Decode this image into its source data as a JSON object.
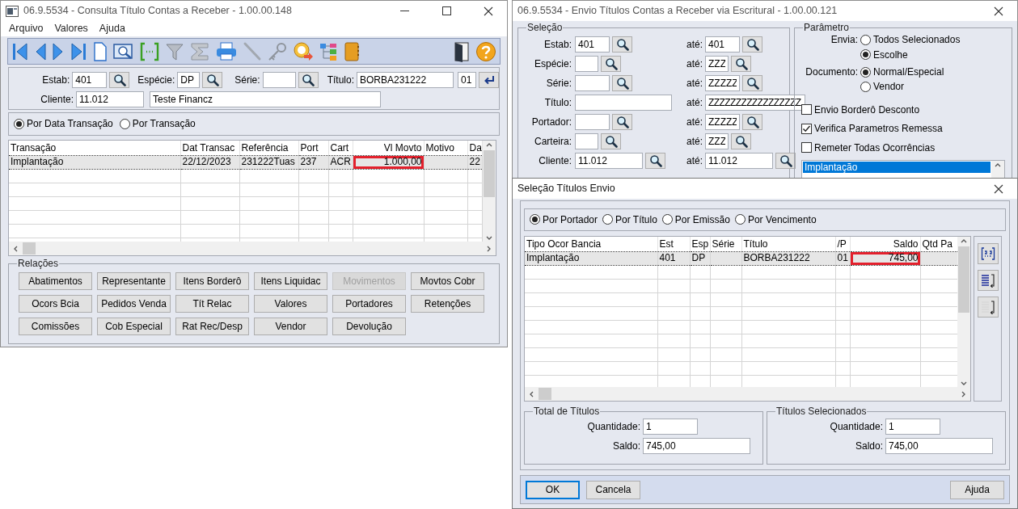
{
  "consulta": {
    "title": "06.9.5534 - Consulta Título Contas a Receber - 1.00.00.148",
    "menu": [
      "Arquivo",
      "Valores",
      "Ajuda"
    ],
    "filter": {
      "estab_label": "Estab:",
      "estab": "401",
      "especie_label": "Espécie:",
      "especie": "DP",
      "serie_label": "Série:",
      "titulo_label": "Título:",
      "titulo": "BORBA231222",
      "parcela": "01",
      "cliente_label": "Cliente:",
      "cliente": "11.012",
      "cliente_nome": "Teste Financz"
    },
    "order_options": [
      {
        "label": "Por Data Transação",
        "selected": true
      },
      {
        "label": "Por Transação",
        "selected": false
      }
    ],
    "grid": {
      "columns": [
        {
          "label": "Transação",
          "kind": "text",
          "highlighted": false
        },
        {
          "label": "Dat Transac",
          "kind": "text",
          "highlighted": false
        },
        {
          "label": "Referência",
          "kind": "text",
          "highlighted": false
        },
        {
          "label": "Port",
          "kind": "text",
          "highlighted": false
        },
        {
          "label": "Cart",
          "kind": "text",
          "highlighted": false
        },
        {
          "label": "Vl Movto",
          "kind": "number",
          "highlighted": true
        },
        {
          "label": "Motivo",
          "kind": "text",
          "highlighted": false
        },
        {
          "label": "Da",
          "kind": "text",
          "highlighted": false
        }
      ],
      "rows": [
        {
          "selected": true,
          "cells": [
            "Implantação",
            "22/12/2023",
            "231222Tuas",
            "237",
            "ACR",
            "1.000,00",
            null,
            "22"
          ]
        }
      ]
    },
    "relations": {
      "title": "Relações",
      "buttons": [
        {
          "label": "Abatimentos",
          "disabled": false
        },
        {
          "label": "Representante",
          "disabled": false
        },
        {
          "label": "Itens Borderô",
          "disabled": false
        },
        {
          "label": "Itens Liquidac",
          "disabled": false
        },
        {
          "label": "Movimentos",
          "disabled": true
        },
        {
          "label": "Movtos Cobr",
          "disabled": false
        },
        {
          "label": "Ocors Bcia",
          "disabled": false
        },
        {
          "label": "Pedidos Venda",
          "disabled": false
        },
        {
          "label": "Tít  Relac",
          "disabled": false
        },
        {
          "label": "Valores",
          "disabled": false
        },
        {
          "label": "Portadores",
          "disabled": false
        },
        {
          "label": "Retenções",
          "disabled": false
        },
        {
          "label": "Comissões",
          "disabled": false
        },
        {
          "label": "Cob Especial",
          "disabled": false
        },
        {
          "label": "Rat Rec/Desp",
          "disabled": false
        },
        {
          "label": "Vendor",
          "disabled": false
        },
        {
          "label": "Devolução",
          "disabled": false
        }
      ]
    }
  },
  "envio": {
    "title": "06.9.5534 - Envio Títulos Contas a Receber via Escritural - 1.00.00.121",
    "selection": {
      "title": "Seleção",
      "rows": [
        {
          "label": "Estab:",
          "from": "401",
          "to_label": "até:",
          "to": "401",
          "lookup": true
        },
        {
          "label": "Espécie:",
          "to_label": "até:",
          "to": "ZZZ",
          "lookup": true
        },
        {
          "label": "Série:",
          "to_label": "até:",
          "to": "ZZZZZ",
          "lookup": true
        },
        {
          "label": "Título:",
          "to_label": "até:",
          "to": "ZZZZZZZZZZZZZZZZZ",
          "lookup": false
        },
        {
          "label": "Portador:",
          "to_label": "até:",
          "to": "ZZZZZ",
          "lookup": true
        },
        {
          "label": "Carteira:",
          "to_label": "até:",
          "to": "ZZZ",
          "lookup": true
        },
        {
          "label": "Cliente:",
          "from": "11.012",
          "to_label": "até:",
          "to": "11.012",
          "lookup": true
        }
      ]
    },
    "parameters": {
      "title": "Parâmetro",
      "envia_label": "Envia:",
      "envia": [
        {
          "label": "Todos Selecionados",
          "selected": false
        },
        {
          "label": "Escolhe",
          "selected": true
        }
      ],
      "documento_label": "Documento:",
      "documento": [
        {
          "label": "Normal/Especial",
          "selected": true
        },
        {
          "label": "Vendor",
          "selected": false
        }
      ],
      "checks": [
        {
          "label": "Envio Borderô Desconto",
          "checked": false
        },
        {
          "label": "Verifica Parametros Remessa",
          "checked": true
        },
        {
          "label": "Remeter Todas Ocorrências",
          "checked": false
        }
      ],
      "occurrences": [
        {
          "label": "Implantação",
          "selected": true
        }
      ]
    }
  },
  "dialog": {
    "title": "Seleção Títulos Envio",
    "sort_options": [
      {
        "label": "Por Portador",
        "selected": true
      },
      {
        "label": "Por Título",
        "selected": false
      },
      {
        "label": "Por Emissão",
        "selected": false
      },
      {
        "label": "Por Vencimento",
        "selected": false
      }
    ],
    "grid": {
      "columns": [
        {
          "label": "Tipo Ocor Bancia",
          "kind": "text",
          "highlighted": false
        },
        {
          "label": "Est",
          "kind": "text",
          "highlighted": false
        },
        {
          "label": "Esp",
          "kind": "text",
          "highlighted": false
        },
        {
          "label": "Série",
          "kind": "text",
          "highlighted": false
        },
        {
          "label": "Título",
          "kind": "text",
          "highlighted": false
        },
        {
          "label": "/P",
          "kind": "text",
          "highlighted": false
        },
        {
          "label": "Saldo",
          "kind": "number",
          "highlighted": true
        },
        {
          "label": "Qtd Pa",
          "kind": "text",
          "highlighted": false
        }
      ],
      "rows": [
        {
          "selected": true,
          "cells": [
            "Implantação",
            "401",
            "DP",
            null,
            "BORBA231222",
            "01",
            "745,00",
            null
          ]
        }
      ]
    },
    "totals": [
      {
        "title": "Total de Títulos",
        "quantidade_label": "Quantidade:",
        "quantidade": "1",
        "saldo_label": "Saldo:",
        "saldo": "745,00"
      },
      {
        "title": "Títulos Selecionados",
        "quantidade_label": "Quantidade:",
        "quantidade": "1",
        "saldo_label": "Saldo:",
        "saldo": "745,00"
      }
    ],
    "buttons": [
      {
        "label": "OK",
        "default": true,
        "kind": "action"
      },
      {
        "label": "Cancela",
        "default": false,
        "kind": "action"
      },
      {
        "label": "Ajuda",
        "default": false,
        "kind": "help"
      }
    ]
  }
}
